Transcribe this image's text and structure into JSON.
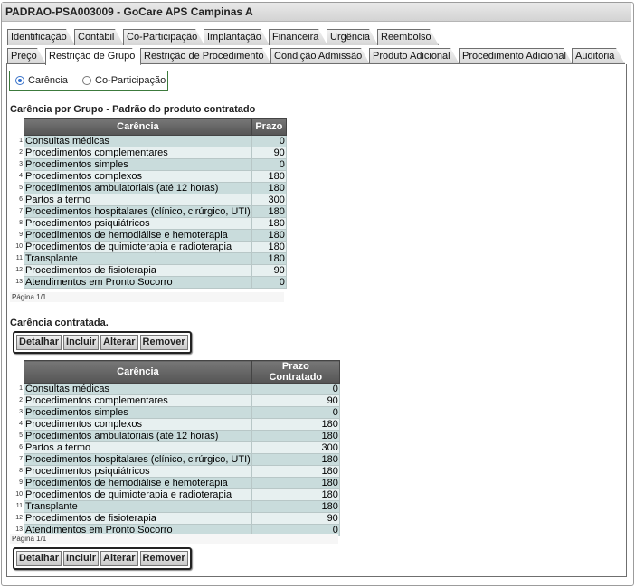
{
  "window": {
    "title": "PADRAO-PSA003009 - GoCare APS Campinas A"
  },
  "tabs_row1": [
    {
      "label": "Identificação"
    },
    {
      "label": "Contábil"
    },
    {
      "label": "Co-Participação"
    },
    {
      "label": "Implantação"
    },
    {
      "label": "Financeira"
    },
    {
      "label": "Urgência"
    },
    {
      "label": "Reembolso"
    }
  ],
  "tabs_row2": [
    {
      "label": "Preço"
    },
    {
      "label": "Restrição de Grupo",
      "active": true
    },
    {
      "label": "Restrição de Procedimento"
    },
    {
      "label": "Condição Admissão"
    },
    {
      "label": "Produto Adicional"
    },
    {
      "label": "Procedimento Adicional"
    },
    {
      "label": "Auditoria"
    }
  ],
  "filter": {
    "options": [
      {
        "label": "Carência",
        "selected": true
      },
      {
        "label": "Co-Participação",
        "selected": false
      }
    ]
  },
  "section1": {
    "heading": "Carência por Grupo - Padrão do produto contratado",
    "columns": [
      "Carência",
      "Prazo"
    ],
    "rows": [
      {
        "n": "1",
        "label": "Consultas médicas",
        "value": "0"
      },
      {
        "n": "2",
        "label": "Procedimentos complementares",
        "value": "90"
      },
      {
        "n": "3",
        "label": "Procedimentos simples",
        "value": "0"
      },
      {
        "n": "4",
        "label": "Procedimentos complexos",
        "value": "180"
      },
      {
        "n": "5",
        "label": "Procedimentos ambulatoriais (até 12 horas)",
        "value": "180"
      },
      {
        "n": "6",
        "label": "Partos a termo",
        "value": "300"
      },
      {
        "n": "7",
        "label": "Procedimentos hospitalares (clínico, cirúrgico, UTI)",
        "value": "180"
      },
      {
        "n": "8",
        "label": "Procedimentos psiquiátricos",
        "value": "180"
      },
      {
        "n": "9",
        "label": "Procedimentos de hemodiálise e hemoterapia",
        "value": "180"
      },
      {
        "n": "10",
        "label": "Procedimentos de quimioterapia e radioterapia",
        "value": "180"
      },
      {
        "n": "11",
        "label": "Transplante",
        "value": "180"
      },
      {
        "n": "12",
        "label": "Procedimentos de fisioterapia",
        "value": "90"
      },
      {
        "n": "13",
        "label": "Atendimentos em Pronto Socorro",
        "value": "0"
      }
    ],
    "pager": "Página 1/1"
  },
  "section2": {
    "heading": "Carência contratada.",
    "columns": [
      "Carência",
      "Prazo Contratado"
    ],
    "rows": [
      {
        "n": "1",
        "label": "Consultas médicas",
        "value": "0"
      },
      {
        "n": "2",
        "label": "Procedimentos complementares",
        "value": "90"
      },
      {
        "n": "3",
        "label": "Procedimentos simples",
        "value": "0"
      },
      {
        "n": "4",
        "label": "Procedimentos complexos",
        "value": "180"
      },
      {
        "n": "5",
        "label": "Procedimentos ambulatoriais (até 12 horas)",
        "value": "180"
      },
      {
        "n": "6",
        "label": "Partos a termo",
        "value": "300"
      },
      {
        "n": "7",
        "label": "Procedimentos hospitalares (clínico, cirúrgico, UTI)",
        "value": "180"
      },
      {
        "n": "8",
        "label": "Procedimentos psiquiátricos",
        "value": "180"
      },
      {
        "n": "9",
        "label": "Procedimentos de hemodiálise e hemoterapia",
        "value": "180"
      },
      {
        "n": "10",
        "label": "Procedimentos de quimioterapia e radioterapia",
        "value": "180"
      },
      {
        "n": "11",
        "label": "Transplante",
        "value": "180"
      },
      {
        "n": "12",
        "label": "Procedimentos de fisioterapia",
        "value": "90"
      },
      {
        "n": "13",
        "label": "Atendimentos em Pronto Socorro",
        "value": "0"
      }
    ],
    "pager": "Página 1/1"
  },
  "buttons": {
    "detalhar": "Detalhar",
    "incluir": "Incluir",
    "alterar": "Alterar",
    "remover": "Remover"
  }
}
